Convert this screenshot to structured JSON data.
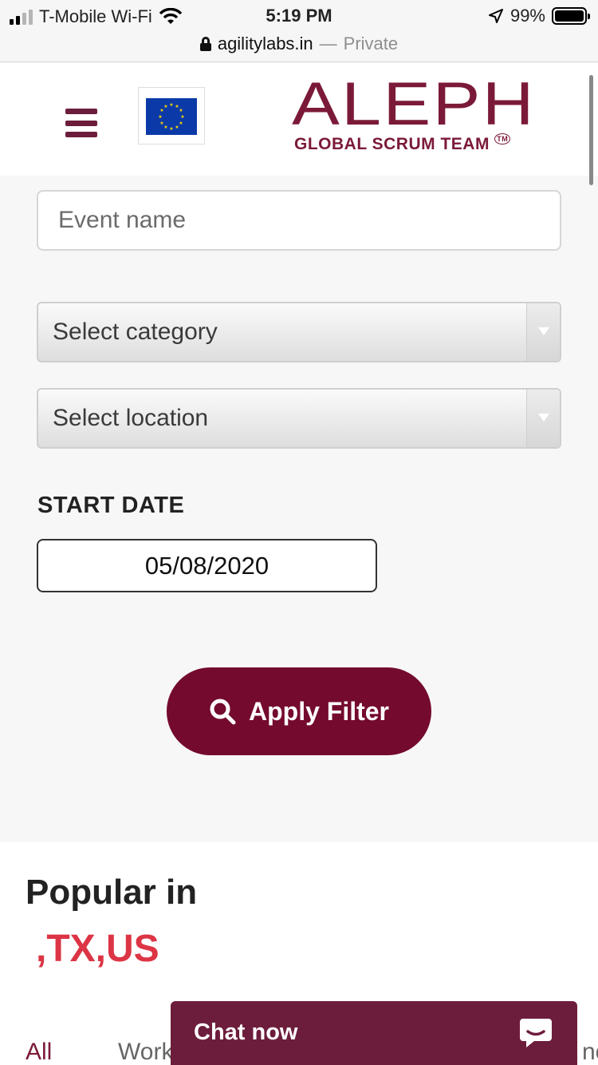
{
  "status_bar": {
    "carrier": "T-Mobile Wi-Fi",
    "time": "5:19 PM",
    "battery": "99%",
    "icons": [
      "signal-icon",
      "wifi-icon",
      "location-arrow-icon",
      "battery-icon"
    ]
  },
  "browser": {
    "domain": "agilitylabs.in",
    "separator": " — ",
    "mode": "Private"
  },
  "header": {
    "logo_main": "ALEPH",
    "logo_sub": "GLOBAL SCRUM TEAM",
    "logo_tm": "TM",
    "brand_color": "#7b1a38"
  },
  "filter": {
    "event_name_placeholder": "Event name",
    "category_label": "Select category",
    "location_label": "Select location",
    "start_date_label": "START DATE",
    "start_date_value": "05/08/2020",
    "apply_label": "Apply Filter",
    "button_color": "#740a2e"
  },
  "popular": {
    "title": "Popular in",
    "location": ",TX,US",
    "tabs": [
      "All",
      "Work",
      "nce"
    ]
  },
  "chat": {
    "label": "Chat now"
  }
}
